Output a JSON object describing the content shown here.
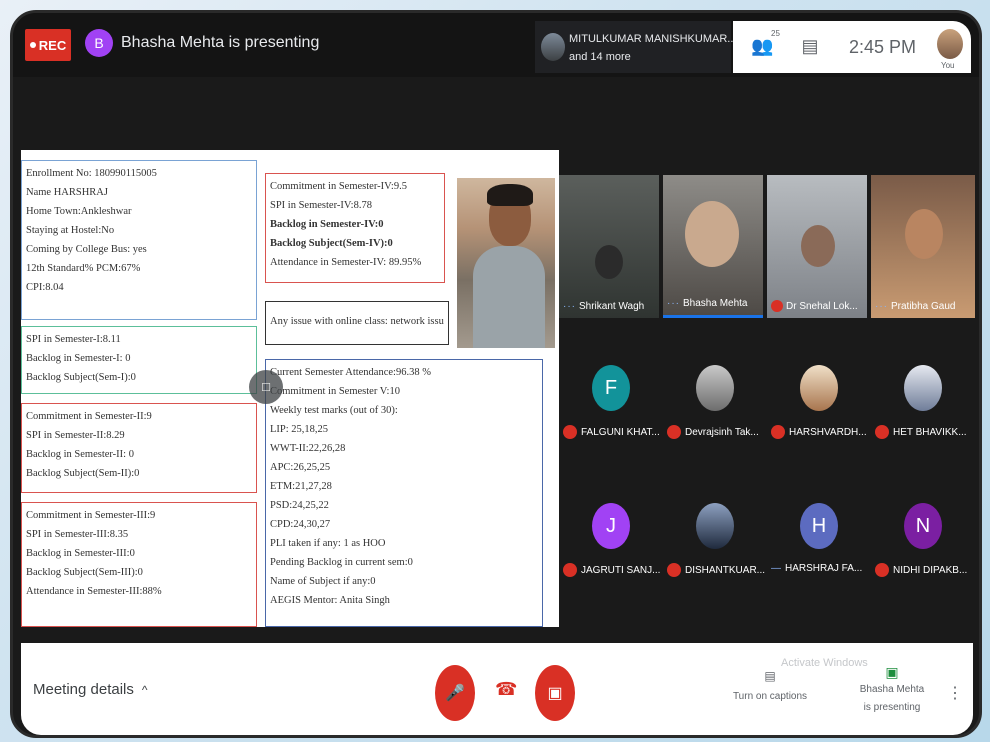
{
  "topbar": {
    "rec_label": "REC",
    "presenter_initial": "B",
    "presenting_text": "Bhasha Mehta is presenting",
    "participants_line1": "MITULKUMAR MANISHKUMAR...",
    "participants_line2": "and 14 more",
    "people_count": "25",
    "time": "2:45 PM",
    "you_label": "You"
  },
  "screen": {
    "box1": [
      "Enrollment No: 180990115005",
      "Name HARSHRAJ",
      "Home Town:Ankleshwar",
      "Staying at Hostel:No",
      "Coming by College Bus: yes",
      "12th Standard% PCM:67%",
      "CPI:8.04"
    ],
    "box2": [
      "SPI in Semester-I:8.11",
      "Backlog in Semester-I: 0",
      "Backlog Subject(Sem-I):0"
    ],
    "box3": [
      "Commitment in Semester-II:9",
      "SPI in Semester-II:8.29",
      "Backlog in Semester-II: 0",
      "Backlog Subject(Sem-II):0"
    ],
    "box4": [
      "Commitment in Semester-III:9",
      "SPI in Semester-III:8.35",
      "Backlog in Semester-III:0",
      "Backlog Subject(Sem-III):0",
      "Attendance in Semester-III:88%"
    ],
    "box5": [
      "Commitment in Semester-IV:9.5",
      "SPI in Semester-IV:8.78",
      "Backlog in Semester-IV:0",
      "Backlog Subject(Sem-IV):0",
      "Attendance in Semester-IV: 89.95%"
    ],
    "box6": "Any issue with online class: network issue",
    "box7": [
      "Current Semester Attendance:96.38 %",
      "Commitment in Semester V:10",
      "Weekly test marks (out of 30):",
      "LIP: 25,18,25",
      "WWT-II:22,26,28",
      "APC:26,25,25",
      "ETM:21,27,28",
      "PSD:24,25,22",
      "CPD:24,30,27",
      "PLI taken if any: 1 as HOO",
      "Pending Backlog in current sem:0",
      "Name of Subject if any:0",
      "AEGIS Mentor: Anita Singh"
    ]
  },
  "videos": [
    {
      "name": "Shrikant Wagh",
      "muted": false
    },
    {
      "name": "Bhasha Mehta",
      "muted": false
    },
    {
      "name": "Dr Snehal Lok...",
      "muted": true
    },
    {
      "name": "Pratibha Gaud",
      "muted": false
    }
  ],
  "participants": [
    {
      "initial": "F",
      "name": "FALGUNI KHAT...",
      "color": "#12939a"
    },
    {
      "initial": "",
      "name": "Devrajsinh Tak...",
      "color": "#a0a0a0"
    },
    {
      "initial": "",
      "name": "HARSHVARDH...",
      "color": "#d9b48c"
    },
    {
      "initial": "",
      "name": "HET BHAVIKK...",
      "color": "#c2c8d6"
    },
    {
      "initial": "J",
      "name": "JAGRUTI SANJ...",
      "color": "#a142f4"
    },
    {
      "initial": "",
      "name": "DISHANTKUAR...",
      "color": "#3a4a6b"
    },
    {
      "initial": "H",
      "name": "HARSHRAJ FA...",
      "color": "#5c6bc0"
    },
    {
      "initial": "N",
      "name": "NIDHI DIPAKB...",
      "color": "#7b1fa2"
    }
  ],
  "bottombar": {
    "meeting_details": "Meeting details",
    "captions_label": "Turn on captions",
    "present_line1": "Bhasha Mehta",
    "present_line2": "is presenting",
    "watermark": "Activate Windows"
  }
}
